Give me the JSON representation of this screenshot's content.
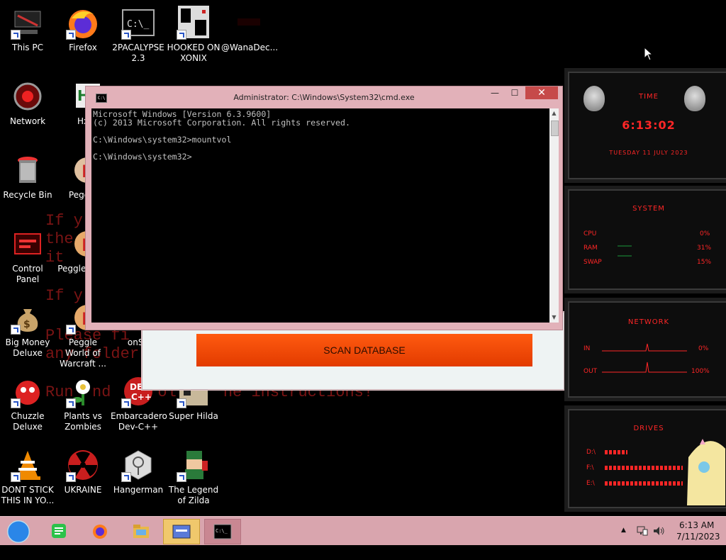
{
  "desktop": {
    "icons": [
      {
        "label": "This PC"
      },
      {
        "label": "Firefox"
      },
      {
        "label": "2PACALYPSE 2.3"
      },
      {
        "label": "HOOKED ON XONIX"
      },
      {
        "label": "@WanaDec..."
      },
      {
        "label": "Network"
      },
      {
        "label": "Hx"
      },
      {
        "label": "Recycle Bin"
      },
      {
        "label": "Peggle"
      },
      {
        "label": "Control Panel"
      },
      {
        "label": "Peggle Delu"
      },
      {
        "label": "Big Money Deluxe"
      },
      {
        "label": "Peggle World of Warcraft ..."
      },
      {
        "label": "onSp"
      },
      {
        "label": "Chuzzle Deluxe"
      },
      {
        "label": "Plants vs Zombies"
      },
      {
        "label": "Embarcadero Dev-C++"
      },
      {
        "label": "Super Hilda"
      },
      {
        "label": "DONT STICK THIS IN YO..."
      },
      {
        "label": "UKRAINE"
      },
      {
        "label": "Hangerman"
      },
      {
        "label": "The Legend of Zilda"
      }
    ],
    "background_text": {
      "line1": "If y",
      "line2": "the",
      "line3": "it",
      "line4": "If y",
      "line5": "Please fi",
      "line6": "any folder",
      "line7": "Run  nd     ollow  he instructions!"
    }
  },
  "app_window": {
    "scan_button": "SCAN DATABASE"
  },
  "cmd": {
    "title": "Administrator: C:\\Windows\\System32\\cmd.exe",
    "icon_label": "C:\\",
    "lines": [
      "Microsoft Windows [Version 6.3.9600]",
      "(c) 2013 Microsoft Corporation. All rights reserved.",
      "",
      "C:\\Windows\\system32>mountvol",
      "",
      "C:\\Windows\\system32>"
    ],
    "minimize": "—",
    "maximize": "☐",
    "close": "✕"
  },
  "gadgets": {
    "time": {
      "title": "TIME",
      "clock": "6:13:02",
      "date": "TUESDAY 11 JULY 2023"
    },
    "system": {
      "title": "SYSTEM",
      "rows": [
        {
          "name": "CPU",
          "value": "0%"
        },
        {
          "name": "RAM",
          "value": "31%"
        },
        {
          "name": "SWAP",
          "value": "15%"
        }
      ]
    },
    "network": {
      "title": "NETWORK",
      "rows": [
        {
          "name": "IN",
          "value": "0%"
        },
        {
          "name": "OUT",
          "value": "100%"
        }
      ]
    },
    "drives": {
      "title": "DRIVES",
      "rows": [
        {
          "name": "D:\\"
        },
        {
          "name": "F:\\"
        },
        {
          "name": "E:\\"
        }
      ]
    }
  },
  "taskbar": {
    "time": "6:13 AM",
    "date": "7/11/2023",
    "tray_arrow": "▲"
  },
  "colors": {
    "accent_red": "#ff2626",
    "taskbar": "#d9a5ae",
    "cmd_frame": "#e2b1b9"
  }
}
